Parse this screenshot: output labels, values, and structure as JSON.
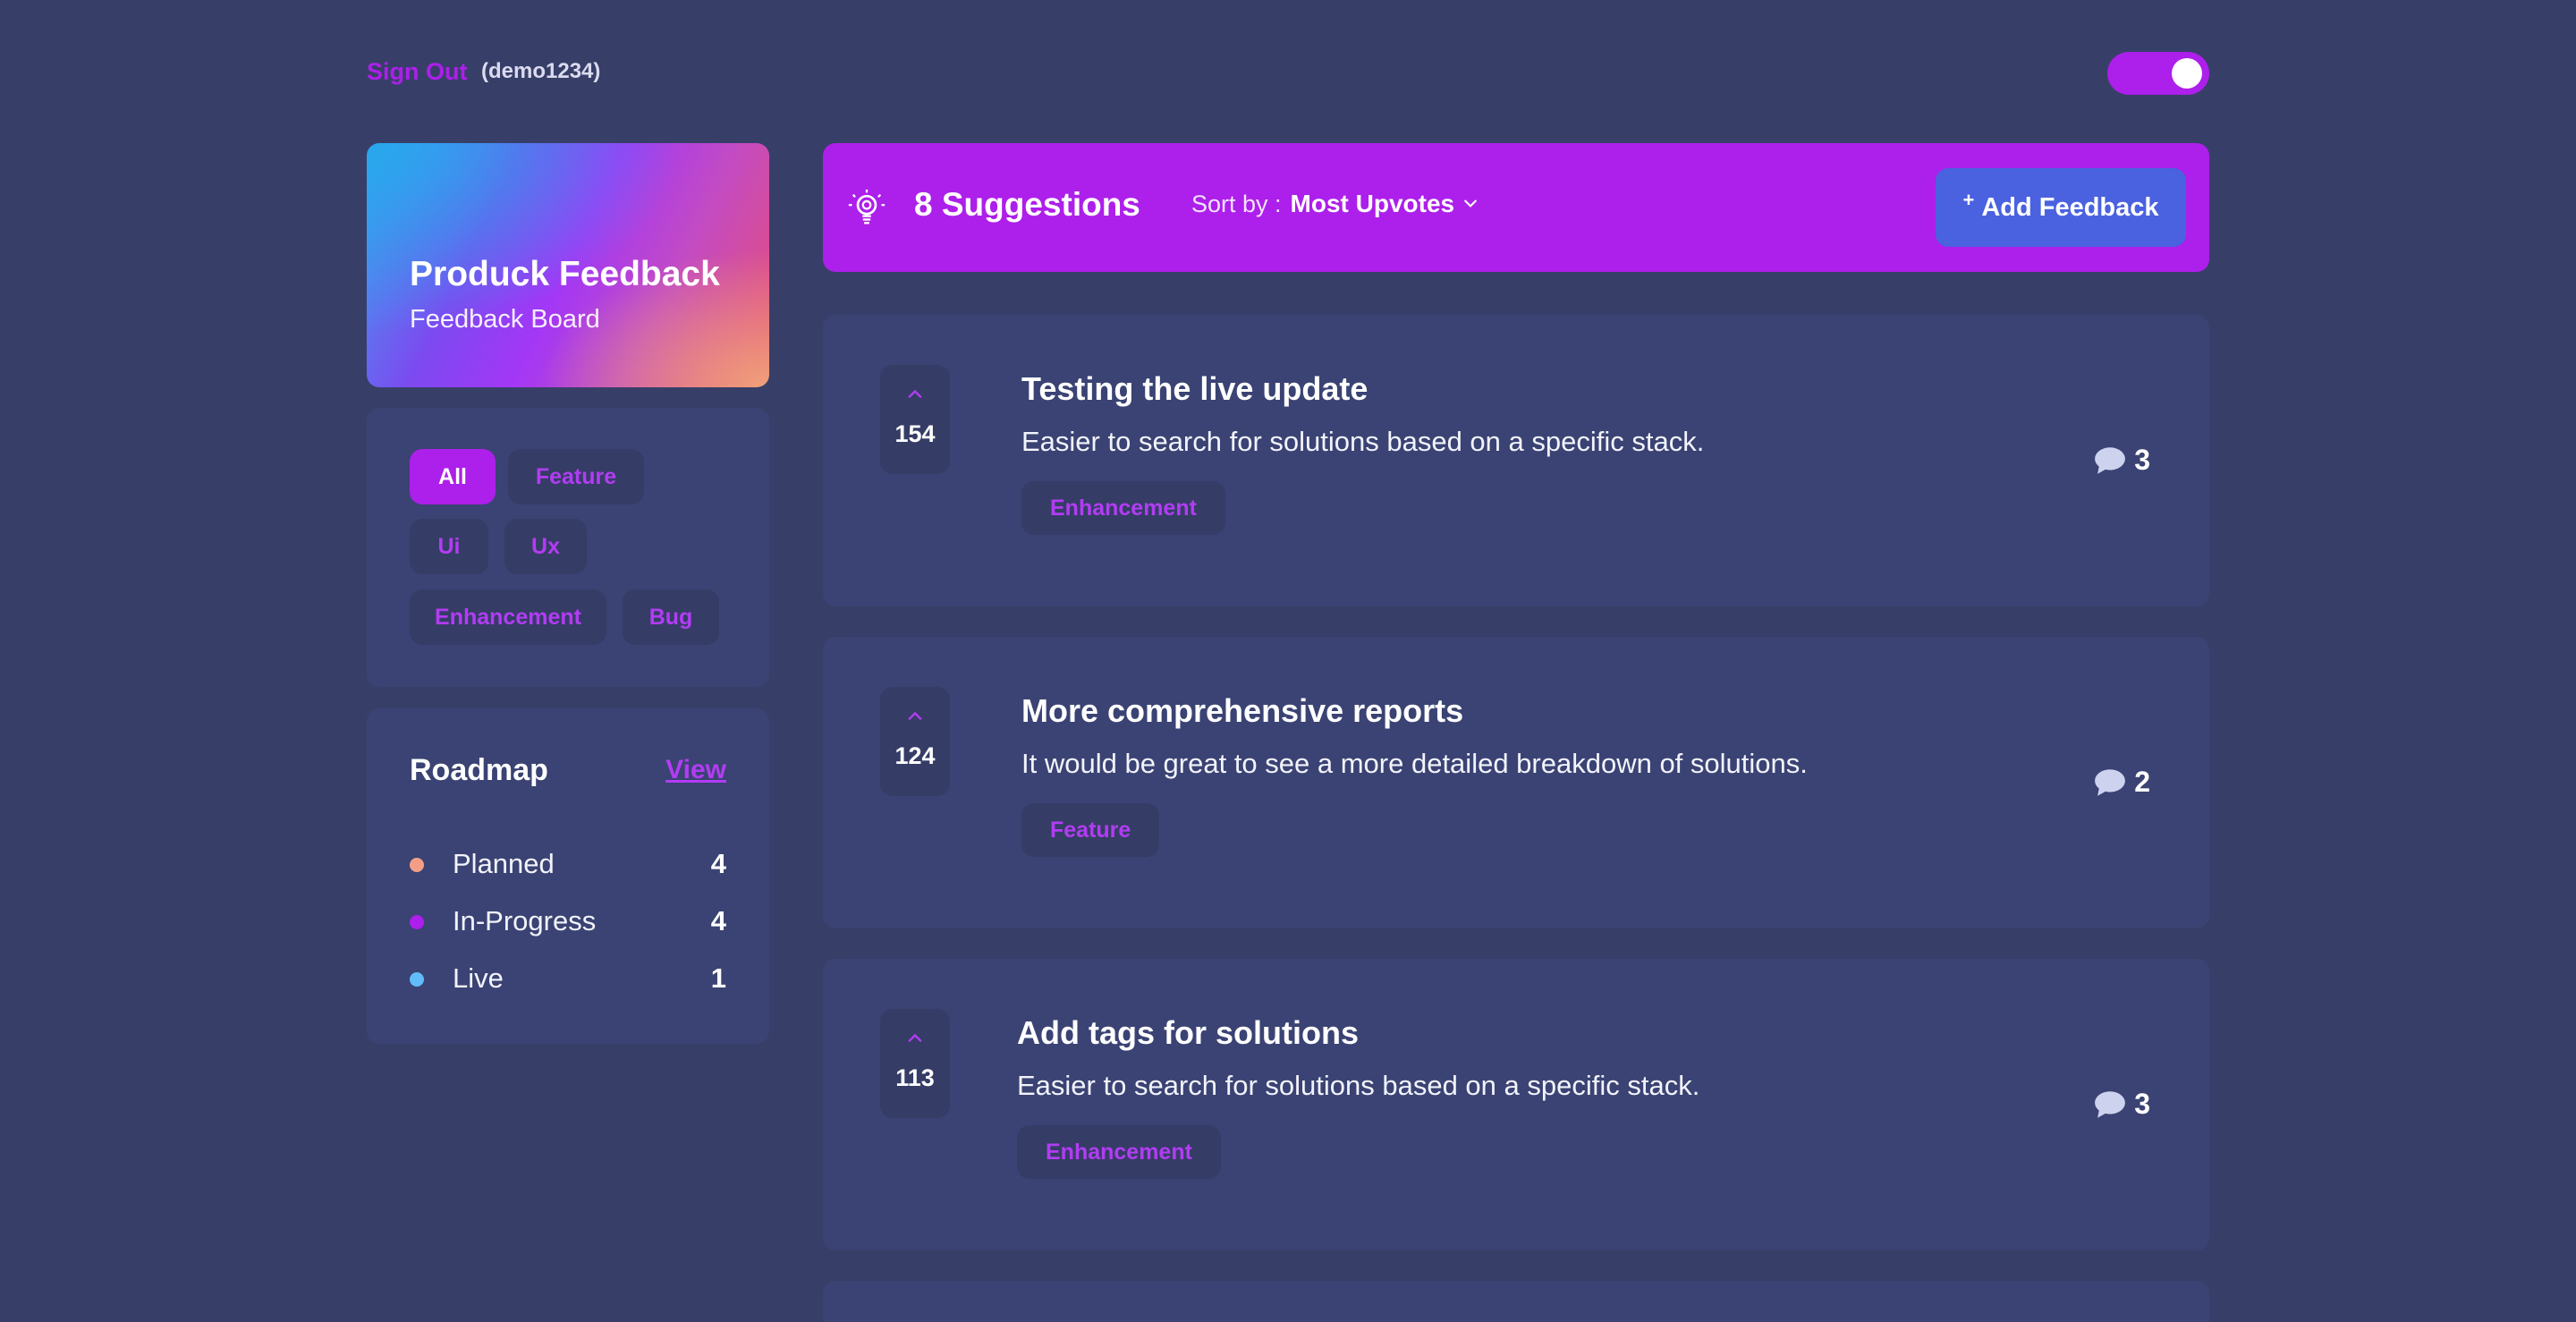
{
  "topbar": {
    "signout_label": "Sign Out",
    "username": "(demo1234)"
  },
  "theme_toggle": {
    "on": true
  },
  "brand": {
    "title": "Produck Feedback",
    "subtitle": "Feedback Board"
  },
  "filters": {
    "tags": [
      {
        "label": "All",
        "active": true
      },
      {
        "label": "Feature",
        "active": false
      },
      {
        "label": "Ui",
        "active": false
      },
      {
        "label": "Ux",
        "active": false
      },
      {
        "label": "Enhancement",
        "active": false
      },
      {
        "label": "Bug",
        "active": false
      }
    ]
  },
  "roadmap": {
    "title": "Roadmap",
    "view_label": "View",
    "items": [
      {
        "label": "Planned",
        "count": "4",
        "color": "#f49f85"
      },
      {
        "label": "In-Progress",
        "count": "4",
        "color": "#ad1fea"
      },
      {
        "label": "Live",
        "count": "1",
        "color": "#62bcfa"
      }
    ]
  },
  "header": {
    "suggestions_count": "8 Suggestions",
    "sort_prefix": "Sort by :",
    "sort_value": "Most Upvotes",
    "add_button_plus": "+",
    "add_button_label": "Add Feedback"
  },
  "suggestions": [
    {
      "upvotes": "154",
      "title": "Testing the live update",
      "description": "Easier to search for solutions based on a specific stack.",
      "tag": "Enhancement",
      "comments": "3"
    },
    {
      "upvotes": "124",
      "title": "More comprehensive reports",
      "description": "It would be great to see a more detailed breakdown of solutions.",
      "tag": "Feature",
      "comments": "2"
    },
    {
      "upvotes": "113",
      "title": "Add tags for solutions",
      "description": "Easier to search for solutions based on a specific stack.",
      "tag": "Enhancement",
      "comments": "3"
    }
  ],
  "colors": {
    "background": "#373f68",
    "accent_purple": "#ad1fea",
    "accent_blue": "#4a61e0",
    "card": "#3a4373"
  },
  "icons": {
    "bulb": "bulb-icon",
    "sort_chevron": "chevron-down-icon",
    "upvote": "chevron-up-icon",
    "comments": "comment-bubble-icon"
  }
}
